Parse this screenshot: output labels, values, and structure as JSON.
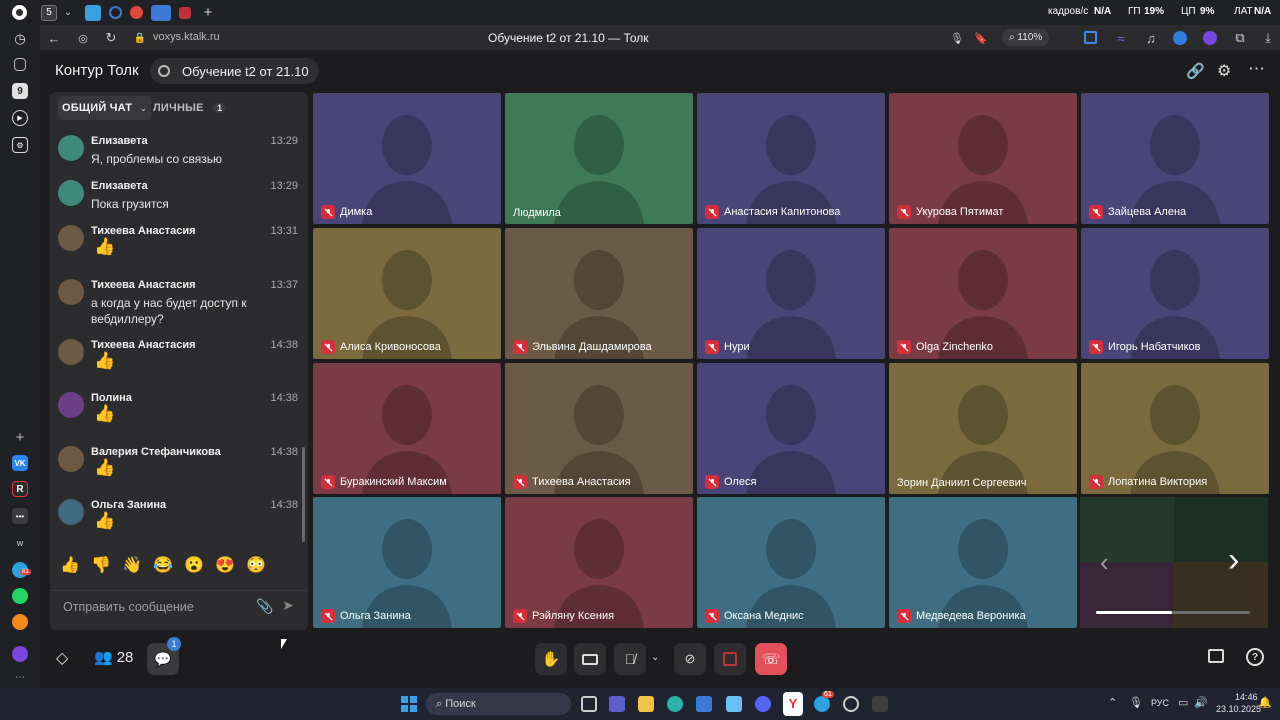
{
  "browser": {
    "tab_badge": "5",
    "hud": {
      "fps_label": "кадров/с",
      "fps_value": "N/A",
      "gpu_label": "ГП",
      "gpu_value": "19%",
      "cpu_label": "ЦП",
      "cpu_value": "9%",
      "lat_label": "ЛАТ",
      "lat_value": "N/A"
    },
    "url": "voxys.ktalk.ru",
    "page_title": "Обучение t2 от 21.10 — Толк",
    "zoom": "110%",
    "sidebar_badge": "61"
  },
  "app": {
    "brand": "Контур Толк",
    "meeting_title": "Обучение t2 от 21.10"
  },
  "chat": {
    "tab_general": "ОБЩИЙ ЧАТ",
    "tab_private": "ЛИЧНЫЕ",
    "tab_private_count": "1",
    "messages": [
      {
        "author": "Елизавета",
        "time": "13:29",
        "text": "Я, проблемы со связью",
        "avatar_color": "#3f8a7c"
      },
      {
        "author": "Елизавета",
        "time": "13:29",
        "text": "Пока грузится",
        "avatar_color": "#3f8a7c"
      },
      {
        "author": "Тихеева Анастасия",
        "time": "13:31",
        "text": "👍",
        "avatar_color": "#6e5a44"
      },
      {
        "author": "Тихеева Анастасия",
        "time": "13:37",
        "text": "а когда у нас будет доступ к вебдиллеру?",
        "avatar_color": "#6e5a44"
      },
      {
        "author": "Тихеева Анастасия",
        "time": "14:38",
        "text": "👍",
        "avatar_color": "#6e5a44"
      },
      {
        "author": "Полина",
        "time": "14:38",
        "text": "👍",
        "avatar_color": "#6a3f88"
      },
      {
        "author": "Валерия Стефанчикова",
        "time": "14:38",
        "text": "👍",
        "avatar_color": "#6e5a44"
      },
      {
        "author": "Ольга Занина",
        "time": "14:38",
        "text": "👍",
        "avatar_color": "#3d6a80"
      }
    ],
    "reactions": [
      "👍",
      "👎",
      "👋",
      "😂",
      "😮",
      "😍",
      "😳"
    ],
    "compose_placeholder": "Отправить сообщение"
  },
  "participants": [
    {
      "name": "Димка",
      "muted": true,
      "color": "#4a4578"
    },
    {
      "name": "Людмила",
      "muted": false,
      "color": "#3f7a58"
    },
    {
      "name": "Анастасия Капитонова",
      "muted": true,
      "color": "#4a4578"
    },
    {
      "name": "Укурова Пятимат",
      "muted": true,
      "color": "#7a3b44"
    },
    {
      "name": "Зайцева Алена",
      "muted": true,
      "color": "#4a4578"
    },
    {
      "name": "Алиса Кривоносова",
      "muted": true,
      "color": "#7a6a3e"
    },
    {
      "name": "Эльвина Дашдамирова",
      "muted": true,
      "color": "#6b5a45"
    },
    {
      "name": "Нури",
      "muted": true,
      "color": "#4a4578"
    },
    {
      "name": "Olga Zinchenko",
      "muted": true,
      "color": "#7a3b44"
    },
    {
      "name": "Игорь Набатчиков",
      "muted": true,
      "color": "#4a4578"
    },
    {
      "name": "Буракинский Максим",
      "muted": true,
      "color": "#7a3b44"
    },
    {
      "name": "Тихеева Анастасия",
      "muted": true,
      "color": "#6b5a45"
    },
    {
      "name": "Олеся",
      "muted": true,
      "color": "#4a4578"
    },
    {
      "name": "Зорин Даниил Сергеевич",
      "muted": false,
      "color": "#7a6a3e"
    },
    {
      "name": "Лопатина Виктория",
      "muted": true,
      "color": "#7a6a3e"
    },
    {
      "name": "Ольга Занина",
      "muted": true,
      "color": "#3f6e82"
    },
    {
      "name": "Рэйляну Ксения",
      "muted": true,
      "color": "#7a3b44"
    },
    {
      "name": "Оксана Меднис",
      "muted": true,
      "color": "#3f6e82"
    },
    {
      "name": "Медведева Вероника",
      "muted": true,
      "color": "#3f6e82"
    }
  ],
  "toolbar": {
    "participants_count": "28",
    "chat_badge": "1"
  },
  "taskbar": {
    "search_placeholder": "Поиск",
    "lang": "РУС",
    "time": "14:46",
    "date": "23.10.2025",
    "telegram_badge": "61"
  },
  "colors": {
    "mute_red": "#d4303c",
    "hangup": "#e2505a",
    "badge_blue": "#3a7bd5"
  }
}
